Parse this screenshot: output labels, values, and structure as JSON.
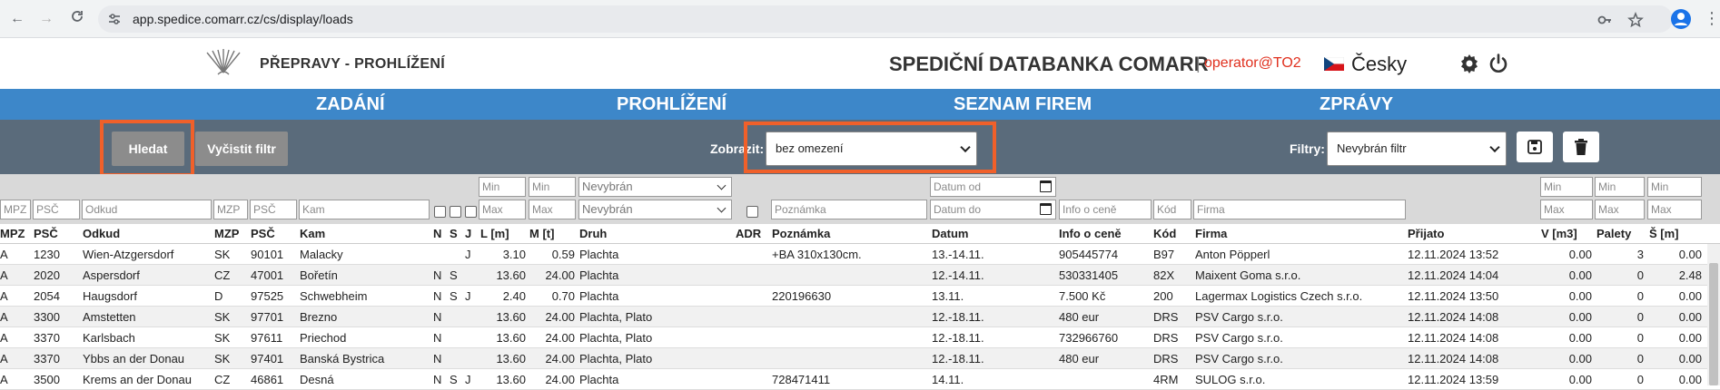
{
  "browser": {
    "url": "app.spedice.comarr.cz/cs/display/loads"
  },
  "header": {
    "page_title": "PŘEPRAVY - PROHLÍŽENÍ",
    "app_title": "SPEDIČNÍ DATABANKA COMARR",
    "separator": "|",
    "operator": "operator@TO2",
    "language": "Česky"
  },
  "nav": {
    "items": [
      "ZADÁNÍ",
      "PROHLÍŽENÍ",
      "SEZNAM FIREM",
      "ZPRÁVY"
    ]
  },
  "toolbar": {
    "search_label": "Hledat",
    "clear_label": "Vyčistit filtr",
    "show_label": "Zobrazit:",
    "show_value": "bez omezení",
    "filters_label": "Filtry:",
    "filters_value": "Nevybrán filtr"
  },
  "filters": {
    "mpz": "MPZ",
    "psc": "PSČ",
    "odkud": "Odkud",
    "mzp": "MZP",
    "psc2": "PSČ",
    "kam": "Kam",
    "min": "Min",
    "max": "Max",
    "druh_top": "Nevybrán",
    "druh_bottom": "Nevybrán",
    "poznamka": "Poznámka",
    "datum_od": "Datum od",
    "datum_do": "Datum do",
    "info": "Info o ceně",
    "kod": "Kód",
    "firma": "Firma"
  },
  "table": {
    "headers": [
      "MPZ",
      "PSČ",
      "Odkud",
      "MZP",
      "PSČ",
      "Kam",
      "N",
      "S",
      "J",
      "L [m]",
      "M [t]",
      "Druh",
      "ADR",
      "Poznámka",
      "Datum",
      "Info o ceně",
      "Kód",
      "Firma",
      "Přijato",
      "V [m3]",
      "Palety",
      "Š [m]"
    ],
    "rows": [
      [
        "A",
        "1230",
        "Wien-Atzgersdorf",
        "SK",
        "90101",
        "Malacky",
        "",
        "",
        "J",
        "3.10",
        "0.59",
        "Plachta",
        "",
        "+BA 310x130cm.",
        "13.-14.11.",
        "905445774",
        "B97",
        "Anton Pöpperl",
        "12.11.2024 13:52",
        "0.00",
        "3",
        "0.00"
      ],
      [
        "A",
        "2020",
        "Aspersdorf",
        "CZ",
        "47001",
        "Bořetín",
        "N",
        "S",
        "",
        "13.60",
        "24.00",
        "Plachta",
        "",
        "",
        "12.-14.11.",
        "530331405",
        "82X",
        "Maixent Goma s.r.o.",
        "12.11.2024 14:04",
        "0.00",
        "0",
        "2.48"
      ],
      [
        "A",
        "2054",
        "Haugsdorf",
        "D",
        "97525",
        "Schwebheim",
        "N",
        "S",
        "J",
        "2.40",
        "0.70",
        "Plachta",
        "",
        "220196630",
        "13.11.",
        "7.500 Kč",
        "200",
        "Lagermax Logistics Czech s.r.o.",
        "12.11.2024 13:50",
        "0.00",
        "0",
        "0.00"
      ],
      [
        "A",
        "3300",
        "Amstetten",
        "SK",
        "97701",
        "Brezno",
        "N",
        "",
        "",
        "13.60",
        "24.00",
        "Plachta, Plato",
        "",
        "",
        "12.-18.11.",
        "480 eur",
        "DRS",
        "PSV Cargo s.r.o.",
        "12.11.2024 14:08",
        "0.00",
        "0",
        "0.00"
      ],
      [
        "A",
        "3370",
        "Karlsbach",
        "SK",
        "97611",
        "Priechod",
        "N",
        "",
        "",
        "13.60",
        "24.00",
        "Plachta, Plato",
        "",
        "",
        "12.-18.11.",
        "732966760",
        "DRS",
        "PSV Cargo s.r.o.",
        "12.11.2024 14:08",
        "0.00",
        "0",
        "0.00"
      ],
      [
        "A",
        "3370",
        "Ybbs an der Donau",
        "SK",
        "97401",
        "Banská Bystrica",
        "N",
        "",
        "",
        "13.60",
        "24.00",
        "Plachta, Plato",
        "",
        "",
        "12.-18.11.",
        "480 eur",
        "DRS",
        "PSV Cargo s.r.o.",
        "12.11.2024 14:08",
        "0.00",
        "0",
        "0.00"
      ],
      [
        "A",
        "3500",
        "Krems an der Donau",
        "CZ",
        "46861",
        "Desná",
        "N",
        "S",
        "J",
        "13.60",
        "24.00",
        "Plachta",
        "",
        "728471411",
        "14.11.",
        "",
        "4RM",
        "SULOG s.r.o.",
        "12.11.2024 13:59",
        "0.00",
        "0",
        "0.00"
      ]
    ]
  },
  "colors": {
    "nav_bg": "#3d87c9",
    "toolbar_bg": "#5a6b7b",
    "highlight": "#f0602a",
    "operator": "#e0301e"
  },
  "icons": [
    "back-arrow-icon",
    "forward-arrow-icon",
    "reload-icon",
    "site-settings-icon",
    "key-icon",
    "star-icon",
    "profile-icon",
    "kebab-menu-icon",
    "logo-icon",
    "flag-cz-icon",
    "gear-icon",
    "power-icon",
    "save-icon",
    "trash-icon",
    "calendar-icon"
  ]
}
